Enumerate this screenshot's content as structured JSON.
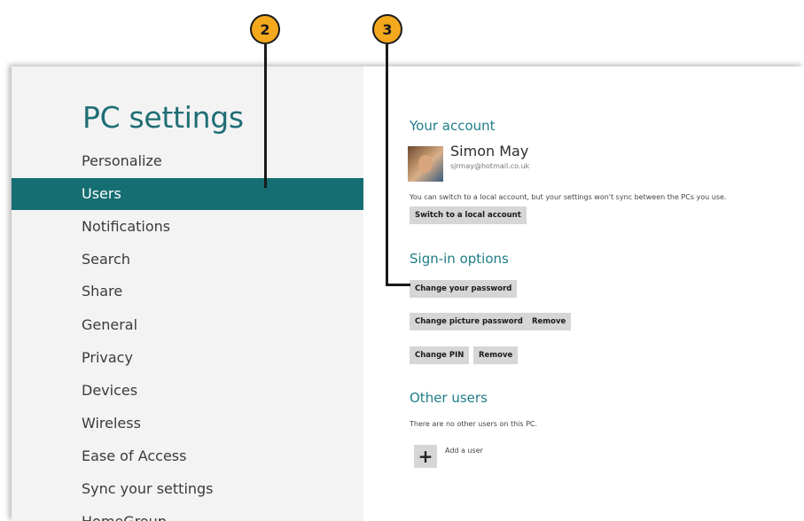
{
  "callouts": {
    "first": "2",
    "second": "3"
  },
  "left_pane": {
    "title": "PC settings",
    "nav_items": [
      {
        "label": "Personalize"
      },
      {
        "label": "Users",
        "selected": true
      },
      {
        "label": "Notifications"
      },
      {
        "label": "Search"
      },
      {
        "label": "Share"
      },
      {
        "label": "General"
      },
      {
        "label": "Privacy"
      },
      {
        "label": "Devices"
      },
      {
        "label": "Wireless"
      },
      {
        "label": "Ease of Access"
      },
      {
        "label": "Sync your settings"
      },
      {
        "label": "HomeGroup"
      }
    ]
  },
  "account": {
    "heading": "Your account",
    "name": "Simon May",
    "email": "sjrmay@hotmail.co.uk",
    "info_text": "You can switch to a local account, but your settings won't sync between the PCs you use.",
    "switch_button": "Switch to a local account"
  },
  "signin": {
    "heading": "Sign-in options",
    "change_password_button": "Change your password",
    "change_picture_password_button": "Change picture password",
    "remove_picture_password_button": "Remove",
    "change_pin_button": "Change PIN",
    "remove_pin_button": "Remove"
  },
  "other_users": {
    "heading": "Other users",
    "info_text": "There are no other users on this PC.",
    "add_icon": "+",
    "add_label": "Add a user"
  },
  "colors": {
    "accent_teal": "#156e72",
    "heading_teal": "#1f7d88",
    "callout_orange": "#f4a81d"
  }
}
